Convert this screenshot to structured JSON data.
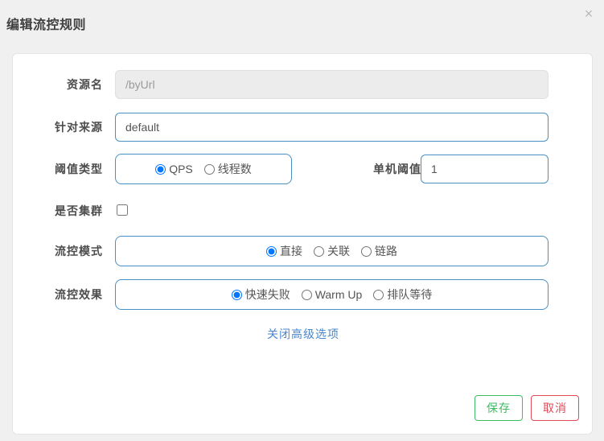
{
  "dialog": {
    "title": "编辑流控规则",
    "close_icon": "close-icon",
    "close_glyph": "×"
  },
  "form": {
    "resource": {
      "label": "资源名",
      "value": "/byUrl",
      "disabled": true
    },
    "origin": {
      "label": "针对来源",
      "value": "default"
    },
    "threshold_type": {
      "label": "阈值类型",
      "options": [
        {
          "label": "QPS",
          "selected": true
        },
        {
          "label": "线程数",
          "selected": false
        }
      ]
    },
    "single_threshold": {
      "label": "单机阈值",
      "value": "1"
    },
    "cluster": {
      "label": "是否集群",
      "checked": false
    },
    "flow_mode": {
      "label": "流控模式",
      "options": [
        {
          "label": "直接",
          "selected": true
        },
        {
          "label": "关联",
          "selected": false
        },
        {
          "label": "链路",
          "selected": false
        }
      ]
    },
    "flow_effect": {
      "label": "流控效果",
      "options": [
        {
          "label": "快速失败",
          "selected": true
        },
        {
          "label": "Warm Up",
          "selected": false
        },
        {
          "label": "排队等待",
          "selected": false
        }
      ]
    }
  },
  "advanced_link": "关闭高级选项",
  "footer": {
    "save_label": "保存",
    "cancel_label": "取消"
  },
  "colors": {
    "background": "#f0f0f0",
    "panel": "#ffffff",
    "border_blue": "#4a90c4",
    "link_blue": "#4a86c8",
    "save_green": "#3cbb63",
    "cancel_red": "#e24a55",
    "label_text": "#4d4d4d",
    "disabled_bg": "#ececec"
  }
}
